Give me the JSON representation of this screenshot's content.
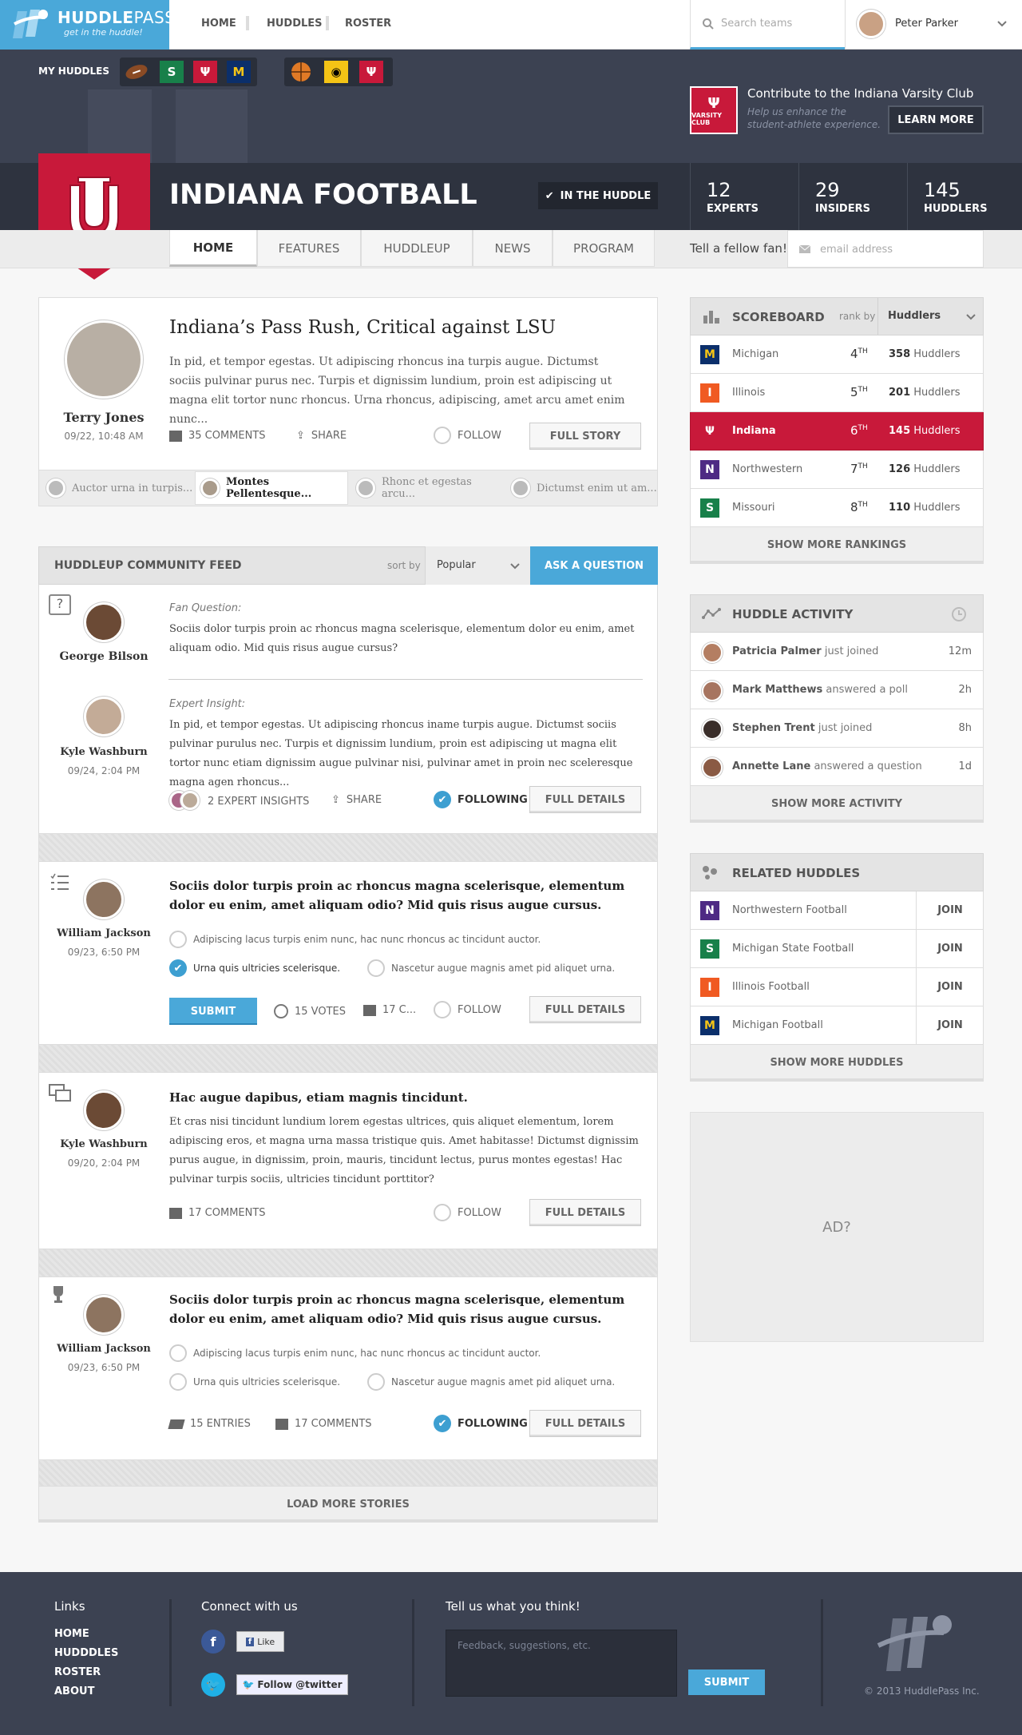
{
  "app": {
    "name": "HUDDLEPASS",
    "name_bold": "HUDDLE",
    "name_light": "PASS",
    "tagline": "get in the huddle!"
  },
  "nav": {
    "home": "HOME",
    "huddles": "HUDDLES",
    "roster": "ROSTER"
  },
  "search": {
    "placeholder": "Search teams"
  },
  "user": {
    "name": "Peter Parker"
  },
  "my_huddles": {
    "label": "MY HUDDLES"
  },
  "contribute": {
    "title": "Contribute to the Indiana Varsity Club",
    "subtitle": "Help us enhance the student-athlete experience.",
    "button": "LEARN MORE",
    "badge": "VARSITY CLUB"
  },
  "team": {
    "title": "INDIANA FOOTBALL",
    "in_huddle": "IN THE HUDDLE"
  },
  "stats": [
    {
      "value": "12",
      "label": "EXPERTS"
    },
    {
      "value": "29",
      "label": "INSIDERS"
    },
    {
      "value": "145",
      "label": "HUDDLERS"
    }
  ],
  "tabs": [
    "HOME",
    "FEATURES",
    "HUDDLEUP",
    "NEWS",
    "PROGRAM"
  ],
  "tell_fan": {
    "label": "Tell a fellow fan!",
    "placeholder": "email address"
  },
  "featured": {
    "title": "Indiana’s Pass Rush, Critical against LSU",
    "body": "In pid, et tempor egestas. Ut adipiscing rhoncus ina turpis augue. Dictumst sociis pulvinar purus nec. Turpis et dignissim lundium, proin est adipiscing ut magna elit tortor nunc rhoncus. Urna rhoncus, adipiscing, amet arcu amet enim nunc...",
    "author": "Terry Jones",
    "date": "09/22, 10:48 AM",
    "comments": "35 COMMENTS",
    "share": "SHARE",
    "follow": "FOLLOW",
    "full_story": "FULL STORY",
    "related": [
      "Auctor urna in turpis...",
      "Montes Pellentesque...",
      "Rhonc et egestas arcu...",
      "Dictumst enim ut am..."
    ]
  },
  "feed": {
    "title": "HUDDLEUP COMMUNITY FEED",
    "sort_label": "sort by",
    "sort_value": "Popular",
    "ask": "ASK A QUESTION",
    "q1": {
      "type": "Fan Question:",
      "text": "Sociis dolor turpis proin ac rhoncus magna scelerisque, elementum dolor eu enim, amet aliquam odio. Mid quis risus augue cursus?",
      "author": "George Bilson",
      "expert_type": "Expert Insight:",
      "expert_text": "In pid, et tempor egestas. Ut adipiscing rhoncus iname turpis augue. Dictumst sociis pulvinar purulus nec. Turpis et dignissim lundium, proin est adipiscing ut magna elit tortor nunc etiam dignissim augue pulvinar nisi, pulvinar amet in proin nec sceleresque magna agen rhoncus...",
      "expert": "Kyle Washburn",
      "expert_date": "09/24, 2:04 PM",
      "insights": "2 EXPERT INSIGHTS",
      "share": "SHARE",
      "following": "FOLLOWING",
      "details": "FULL DETAILS"
    },
    "poll1": {
      "title": "Sociis dolor turpis proin ac rhoncus magna scelerisque, elementum dolor eu enim, amet aliquam odio? Mid quis risus augue cursus.",
      "author": "William Jackson",
      "date": "09/23, 6:50 PM",
      "opt1": "Adipiscing lacus turpis enim nunc, hac nunc rhoncus ac tincidunt auctor.",
      "opt2": "Urna quis ultricies scelerisque.",
      "opt3": "Nascetur augue magnis amet pid aliquet urna.",
      "submit": "SUBMIT",
      "votes": "15 VOTES",
      "comments": "17 C...",
      "follow": "FOLLOW",
      "details": "FULL DETAILS"
    },
    "disc": {
      "title": "Hac augue dapibus, etiam magnis tincidunt.",
      "body": "Et cras nisi tincidunt lundium lorem egestas ultrices, quis aliquet elementum, lorem adipiscing eros, et magna urna massa tristique quis. Amet habitasse! Dictumst dignissim purus augue, in dignissim, proin, mauris, tincidunt lectus, purus montes egestas! Hac pulvinar turpis sociis, ultricies tincidunt porttitor?",
      "author": "Kyle Washburn",
      "date": "09/20, 2:04 PM",
      "comments": "17 COMMENTS",
      "follow": "FOLLOW",
      "details": "FULL DETAILS"
    },
    "contest": {
      "title": "Sociis dolor turpis proin ac rhoncus magna scelerisque, elementum dolor eu enim, amet aliquam odio? Mid quis risus augue cursus.",
      "author": "William Jackson",
      "date": "09/23, 6:50 PM",
      "opt1": "Adipiscing lacus turpis enim nunc, hac nunc rhoncus ac tincidunt auctor.",
      "opt2": "Urna quis ultricies scelerisque.",
      "opt3": "Nascetur augue magnis amet pid aliquet urna.",
      "entries": "15 ENTRIES",
      "comments": "17 COMMENTS",
      "following": "FOLLOWING",
      "details": "FULL DETAILS"
    },
    "load_more": "LOAD MORE STORIES"
  },
  "scoreboard": {
    "title": "SCOREBOARD",
    "rank_by": "rank by",
    "rank_value": "Huddlers",
    "rows": [
      {
        "team": "Michigan",
        "rank": "4",
        "sup": "TH",
        "count": "358",
        "unit": "Huddlers"
      },
      {
        "team": "Illinois",
        "rank": "5",
        "sup": "TH",
        "count": "201",
        "unit": "Huddlers"
      },
      {
        "team": "Indiana",
        "rank": "6",
        "sup": "TH",
        "count": "145",
        "unit": "Huddlers"
      },
      {
        "team": "Northwestern",
        "rank": "7",
        "sup": "TH",
        "count": "126",
        "unit": "Huddlers"
      },
      {
        "team": "Missouri",
        "rank": "8",
        "sup": "TH",
        "count": "110",
        "unit": "Huddlers"
      }
    ],
    "more": "SHOW MORE RANKINGS"
  },
  "activity": {
    "title": "HUDDLE ACTIVITY",
    "rows": [
      {
        "name": "Patricia Palmer",
        "action": "just joined",
        "time": "12m"
      },
      {
        "name": "Mark Matthews",
        "action": "answered a poll",
        "time": "2h"
      },
      {
        "name": "Stephen Trent",
        "action": "just joined",
        "time": "8h"
      },
      {
        "name": "Annette Lane",
        "action": "answered a question",
        "time": "1d"
      }
    ],
    "more": "SHOW MORE ACTIVITY"
  },
  "related": {
    "title": "RELATED HUDDLES",
    "rows": [
      {
        "name": "Northwestern Football",
        "action": "JOIN"
      },
      {
        "name": "Michigan State Football",
        "action": "JOIN"
      },
      {
        "name": "Illinois Football",
        "action": "JOIN"
      },
      {
        "name": "Michigan Football",
        "action": "JOIN"
      }
    ],
    "more": "SHOW MORE HUDDLES"
  },
  "ad": {
    "label": "AD?"
  },
  "footer": {
    "links_title": "Links",
    "links": [
      "HOME",
      "HUDDDLES",
      "ROSTER",
      "ABOUT"
    ],
    "connect_title": "Connect with us",
    "like": "Like",
    "follow_twitter": "Follow @twitter",
    "feedback_title": "Tell us what you think!",
    "feedback_placeholder": "Feedback, suggestions, etc.",
    "submit": "SUBMIT",
    "copyright": "© 2013 HuddlePass Inc."
  },
  "colors": {
    "accent": "#4aa8d9",
    "indiana": "#c8193a",
    "banner": "#3c4252",
    "michigan": "#0b2f6b",
    "maize": "#f4c416",
    "illinois": "#f05a22",
    "northwestern": "#4e2a84",
    "msu": "#18804a"
  }
}
